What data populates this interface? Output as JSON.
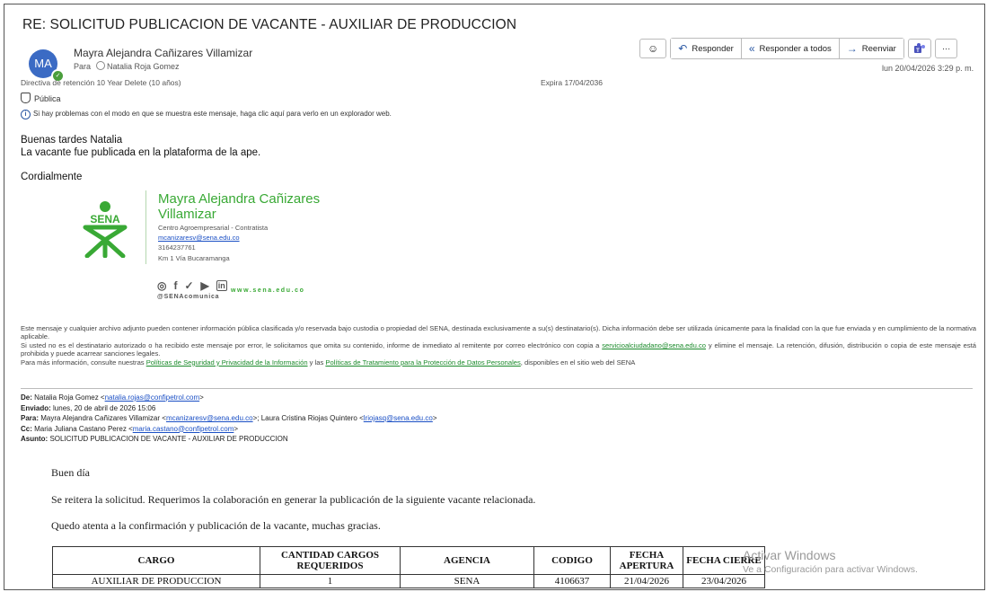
{
  "email": {
    "subject": "RE: SOLICITUD PUBLICACION DE VACANTE - AUXILIAR DE PRODUCCION",
    "avatar_initials": "MA",
    "sender_name": "Mayra Alejandra Cañizares Villamizar",
    "to_label": "Para",
    "to_name": "Natalia Roja Gomez",
    "datetime": "lun 20/04/2026 3:29 p. m.",
    "retention": "Directiva de retención  10 Year Delete (10 años)",
    "expira": "Expira  17/04/2036",
    "visibility": "Pública",
    "info_message": "Si hay problemas con el modo en que se muestra este mensaje, haga clic aquí para verlo en un explorador web."
  },
  "toolbar": {
    "emoji_icon": "smiley-icon",
    "reply_label": "Responder",
    "reply_all_label": "Responder a todos",
    "forward_label": "Reenviar",
    "more_label": "···"
  },
  "body": {
    "greeting": "Buenas tardes Natalia",
    "line1": "La vacante fue publicada en la plataforma de la ape.",
    "closing": "Cordialmente"
  },
  "signature": {
    "name_line1": "Mayra Alejandra Cañizares",
    "name_line2": "Villamizar",
    "org": "Centro Agroempresarial - Contratista",
    "email": "mcanizaresv@sena.edu.co",
    "phone": "3164237761",
    "address": "Km 1 Vía Bucaramanga",
    "logo_text": "SENA",
    "social_handle": "@SENAcomunica",
    "website": "www.sena.edu.co",
    "brand_color": "#39a935"
  },
  "disclaimer": {
    "p1": "Este mensaje y cualquier archivo adjunto pueden contener información pública clasificada y/o reservada bajo custodia o propiedad del SENA, destinada exclusivamente a su(s) destinatario(s). Dicha información debe ser utilizada únicamente para la finalidad con la que fue enviada y en cumplimiento de la normativa aplicable.",
    "p2a": "Si usted no es el destinatario autorizado o ha recibido este mensaje por error, le solicitamos que omita su contenido, informe de inmediato al remitente por correo electrónico con copia a ",
    "p2_link": "servicioalciudadano@sena.edu.co",
    "p2b": " y elimine el mensaje. La retención, difusión, distribución o copia de este mensaje está prohibida y puede acarrear sanciones legales.",
    "p3a": "Para más información, consulte nuestras ",
    "p3_link1": "Políticas de Seguridad y Privacidad de la Información",
    "p3b": " y las ",
    "p3_link2": "Políticas de Tratamiento para la Protección de Datos Personales",
    "p3c": ", disponibles en el sitio web del SENA"
  },
  "quoted": {
    "de_label": "De:",
    "de_name": "Natalia Roja Gomez <",
    "de_email": "natalia.rojas@confipetrol.com",
    "enviado_label": "Enviado:",
    "enviado_value": "lunes, 20 de abril de 2026 15:06",
    "para_label": "Para:",
    "para_name1": "Mayra Alejandra Cañizares Villamizar <",
    "para_email1": "mcanizaresv@sena.edu.co",
    "para_name2": ">; Laura Cristina Riojas Quintero <",
    "para_email2": "lriojasq@sena.edu.co",
    "cc_label": "Cc:",
    "cc_name": "Maria Juliana Castano Perez <",
    "cc_email": "maria.castano@confipetrol.com",
    "asunto_label": "Asunto:",
    "asunto_value": "SOLICITUD PUBLICACION DE VACANTE - AUXILIAR DE PRODUCCION",
    "greeting": "Buen día",
    "line1": "Se reitera la solicitud. Requerimos la colaboración en generar la publicación de la siguiente vacante relacionada.",
    "line2": "Quedo atenta a la confirmación y publicación de la vacante, muchas gracias."
  },
  "vacancy_table": {
    "headers": [
      "CARGO",
      "CANTIDAD CARGOS REQUERIDOS",
      "AGENCIA",
      "CODIGO",
      "FECHA APERTURA",
      "FECHA CIERRE"
    ],
    "row": [
      "AUXILIAR DE PRODUCCION",
      "1",
      "SENA",
      "4106637",
      "21/04/2026",
      "23/04/2026"
    ]
  },
  "watermark": {
    "line1": "Activar Windows",
    "line2": "Ve a Configuración para activar Windows."
  }
}
